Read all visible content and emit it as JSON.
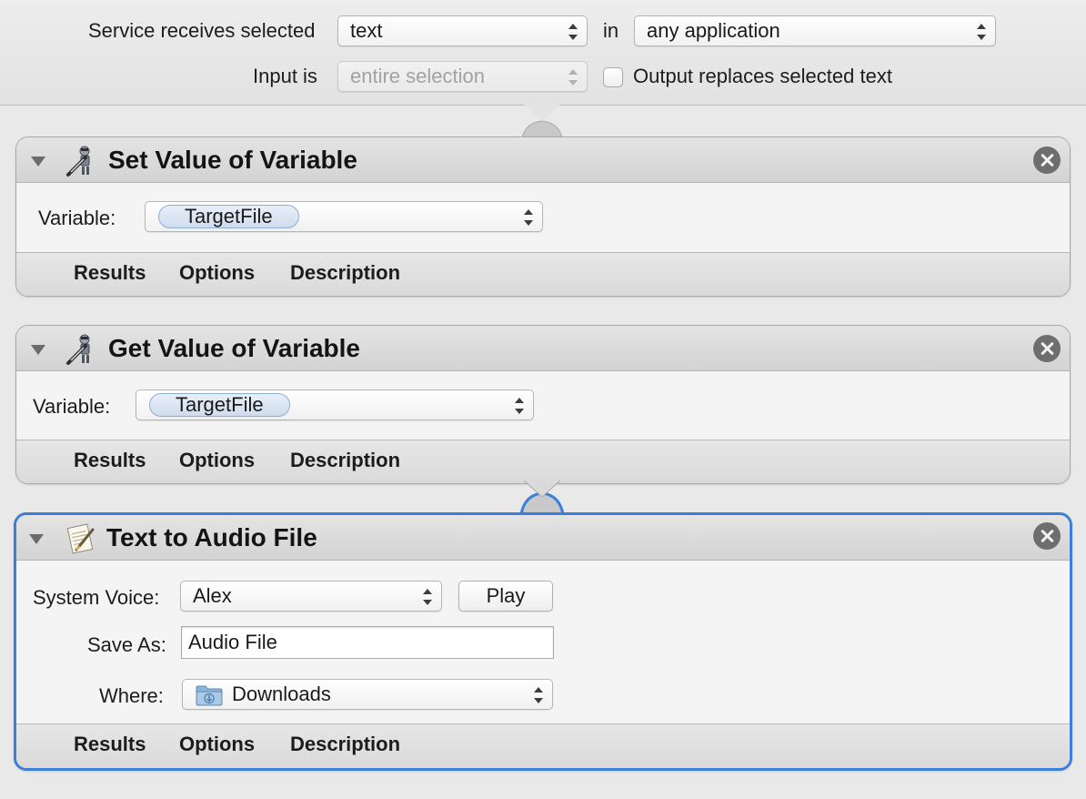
{
  "service": {
    "receives_label": "Service receives selected",
    "receives_value": "text",
    "in_label": "in",
    "application_value": "any application",
    "input_label": "Input is",
    "input_value": "entire selection",
    "output_label": "Output replaces selected text",
    "output_checked": false
  },
  "footer_tabs": {
    "results": "Results",
    "options": "Options",
    "description": "Description"
  },
  "actions": [
    {
      "title": "Set Value of Variable",
      "icon": "variable-robot-icon",
      "variable_label": "Variable:",
      "variable_value": "TargetFile"
    },
    {
      "title": "Get Value of Variable",
      "icon": "variable-robot-icon",
      "variable_label": "Variable:",
      "variable_value": "TargetFile"
    },
    {
      "title": "Text to Audio File",
      "icon": "text-edit-icon",
      "voice_label": "System Voice:",
      "voice_value": "Alex",
      "play_label": "Play",
      "save_as_label": "Save As:",
      "save_as_value": "Audio File",
      "where_label": "Where:",
      "where_value": "Downloads",
      "where_icon": "downloads-folder-icon",
      "selected": true
    }
  ],
  "colors": {
    "selection_border": "#3b7fd9",
    "token_fill": "#dbe6f3",
    "close_button": "#6e6e6e"
  }
}
